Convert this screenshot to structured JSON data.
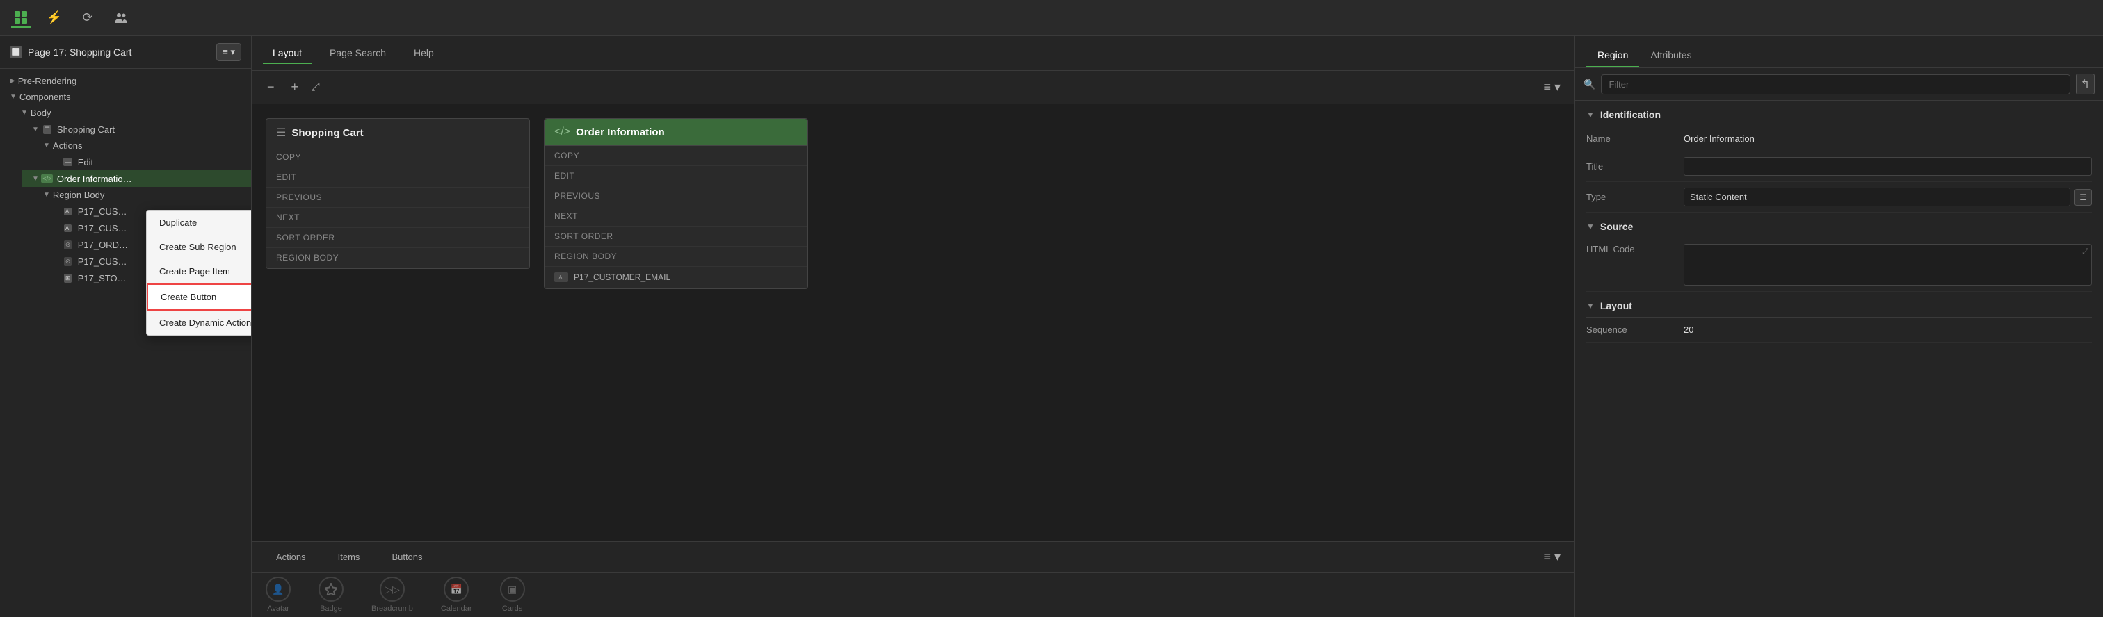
{
  "topNav": {
    "icons": [
      "grid-icon",
      "bolt-icon",
      "refresh-icon",
      "users-icon"
    ]
  },
  "leftSidebar": {
    "pageTitle": "Page 17: Shopping Cart",
    "menuBtnLabel": "≡",
    "tree": [
      {
        "id": "pre-rendering",
        "label": "Pre-Rendering",
        "indent": 0,
        "chevron": "▶",
        "icon": null
      },
      {
        "id": "components",
        "label": "Components",
        "indent": 0,
        "chevron": "▼",
        "icon": null
      },
      {
        "id": "body",
        "label": "Body",
        "indent": 1,
        "chevron": "▼",
        "icon": null
      },
      {
        "id": "shopping-cart",
        "label": "Shopping Cart",
        "indent": 2,
        "chevron": "▼",
        "icon": "cart"
      },
      {
        "id": "actions",
        "label": "Actions",
        "indent": 3,
        "chevron": "▼",
        "icon": null
      },
      {
        "id": "edit",
        "label": "Edit",
        "indent": 4,
        "chevron": null,
        "icon": "minus"
      },
      {
        "id": "order-info",
        "label": "Order Informatio…",
        "indent": 2,
        "chevron": "▼",
        "icon": "code",
        "selected": true
      },
      {
        "id": "region-body",
        "label": "Region Body",
        "indent": 3,
        "chevron": "▼",
        "icon": null
      },
      {
        "id": "p17-cus1",
        "label": "P17_CUS…",
        "indent": 4,
        "chevron": null,
        "icon": "AI"
      },
      {
        "id": "p17-cus2",
        "label": "P17_CUS…",
        "indent": 4,
        "chevron": null,
        "icon": "AI"
      },
      {
        "id": "p17-ord",
        "label": "P17_ORD…",
        "indent": 4,
        "chevron": null,
        "icon": "eye-slash"
      },
      {
        "id": "p17-cus3",
        "label": "P17_CUS…",
        "indent": 4,
        "chevron": null,
        "icon": "eye-slash"
      },
      {
        "id": "p17-sto",
        "label": "P17_STO…",
        "indent": 4,
        "chevron": null,
        "icon": "table"
      }
    ]
  },
  "contextMenu": {
    "items": [
      {
        "id": "duplicate",
        "label": "Duplicate",
        "highlighted": false
      },
      {
        "id": "create-sub-region",
        "label": "Create Sub Region",
        "highlighted": false
      },
      {
        "id": "create-page-item",
        "label": "Create Page Item",
        "highlighted": false
      },
      {
        "id": "create-button",
        "label": "Create Button",
        "highlighted": true
      },
      {
        "id": "create-dynamic-action",
        "label": "Create Dynamic Action",
        "highlighted": false
      }
    ]
  },
  "centerArea": {
    "tabs": [
      {
        "id": "layout",
        "label": "Layout",
        "active": true
      },
      {
        "id": "page-search",
        "label": "Page Search",
        "active": false
      },
      {
        "id": "help",
        "label": "Help",
        "active": false
      }
    ],
    "regions": [
      {
        "id": "shopping-cart-region",
        "title": "Shopping Cart",
        "icon": "☰",
        "greenHeader": false,
        "rows": [
          "COPY",
          "EDIT",
          "PREVIOUS",
          "NEXT",
          "SORT ORDER",
          "REGION BODY"
        ],
        "items": []
      },
      {
        "id": "order-info-region",
        "title": "Order Information",
        "icon": "</>",
        "greenHeader": true,
        "rows": [
          "COPY",
          "EDIT",
          "PREVIOUS",
          "NEXT",
          "SORT ORDER",
          "REGION BODY"
        ],
        "items": [
          "P17_CUSTOMER_EMAIL"
        ]
      }
    ],
    "bottomTabs": [
      {
        "id": "actions-tab",
        "label": "Actions",
        "active": false
      },
      {
        "id": "items-tab",
        "label": "Items",
        "active": false
      },
      {
        "id": "buttons-tab",
        "label": "Buttons",
        "active": false
      }
    ],
    "bottomIcons": [
      {
        "id": "avatar",
        "label": "Avatar",
        "icon": "👤"
      },
      {
        "id": "badge",
        "label": "Badge",
        "icon": "◈"
      },
      {
        "id": "breadcrumb",
        "label": "Breadcrumb",
        "icon": "▷▷"
      },
      {
        "id": "calendar",
        "label": "Calendar",
        "icon": "📅"
      },
      {
        "id": "cards",
        "label": "Cards",
        "icon": "▣"
      }
    ]
  },
  "rightPanel": {
    "tabs": [
      {
        "id": "region-tab",
        "label": "Region",
        "active": true
      },
      {
        "id": "attributes-tab",
        "label": "Attributes",
        "active": false
      }
    ],
    "filterPlaceholder": "Filter",
    "sections": {
      "identification": {
        "label": "Identification",
        "props": [
          {
            "id": "name",
            "label": "Name",
            "value": "Order Information",
            "type": "text"
          },
          {
            "id": "title",
            "label": "Title",
            "value": "",
            "type": "input"
          },
          {
            "id": "type",
            "label": "Type",
            "value": "Static Content",
            "type": "select"
          }
        ]
      },
      "source": {
        "label": "Source",
        "props": [
          {
            "id": "html-code",
            "label": "HTML Code",
            "value": "",
            "type": "textarea"
          }
        ]
      },
      "layout": {
        "label": "Layout",
        "props": [
          {
            "id": "sequence",
            "label": "Sequence",
            "value": "20",
            "type": "text"
          }
        ]
      }
    }
  }
}
